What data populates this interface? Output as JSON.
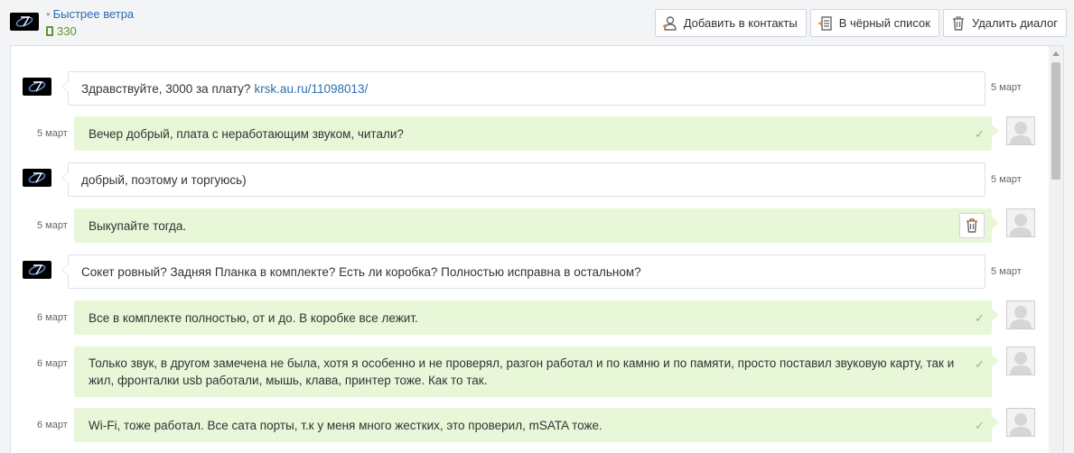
{
  "header": {
    "username": "Быстрее ветра",
    "rating": "330"
  },
  "actions": {
    "add_contact": "Добавить в контакты",
    "blacklist": "В чёрный список",
    "delete_dialog": "Удалить диалог"
  },
  "colors": {
    "link": "#2a6db0",
    "rating": "#5a9a2a",
    "outgoing_bubble": "#e7f7d8",
    "check": "#7ec86a",
    "trash_accent": "#e67e22"
  },
  "messages": [
    {
      "dir": "in",
      "text": "Здравствуйте, 3000 за плату?",
      "link": "krsk.au.ru/11098013/",
      "date": "5 март"
    },
    {
      "dir": "out",
      "text": "Вечер добрый, плата с неработающим звуком, читали?",
      "date": "5 март",
      "read": true
    },
    {
      "dir": "in",
      "text": "добрый, поэтому и торгуюсь)",
      "date": "5 март"
    },
    {
      "dir": "out",
      "text": "Выкупайте тогда.",
      "date": "5 март",
      "read": false
    },
    {
      "dir": "in",
      "text": "Сокет ровный? Задняя Планка в комплекте? Есть ли коробка? Полностью исправна в остальном?",
      "date": "5 март"
    },
    {
      "dir": "out",
      "text": "Все в комплекте полностью, от и до. В коробке все лежит.",
      "date": "6 март",
      "read": true
    },
    {
      "dir": "out",
      "text": "Только звук, в другом замечена не была, хотя я особенно и не проверял, разгон работал и по камню и по памяти, просто поставил звуковую карту, так и жил, фронталки usb работали, мышь, клава, принтер тоже. Как то так.",
      "date": "6 март",
      "read": true
    },
    {
      "dir": "out",
      "text": "Wi-Fi, тоже работал. Все сата порты, т.к у меня много жестких, это проверил, mSATA тоже.",
      "date": "6 март",
      "read": true
    }
  ]
}
